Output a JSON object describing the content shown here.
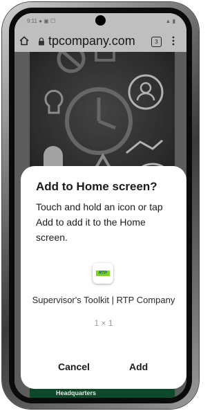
{
  "browser": {
    "url": "tpcompany.com",
    "tab_count": "3"
  },
  "page": {
    "footer_label": "Headquarters"
  },
  "dialog": {
    "title": "Add to Home screen?",
    "message": "Touch and hold an icon or tap Add to add it to the Home screen.",
    "app_name": "Supervisor's Toolkit | RTP Company",
    "app_size": "1 × 1",
    "icon_text": "RTP",
    "cancel_label": "Cancel",
    "add_label": "Add"
  },
  "colors": {
    "brand_green": "#12603a",
    "icon_green": "#7dd421"
  }
}
